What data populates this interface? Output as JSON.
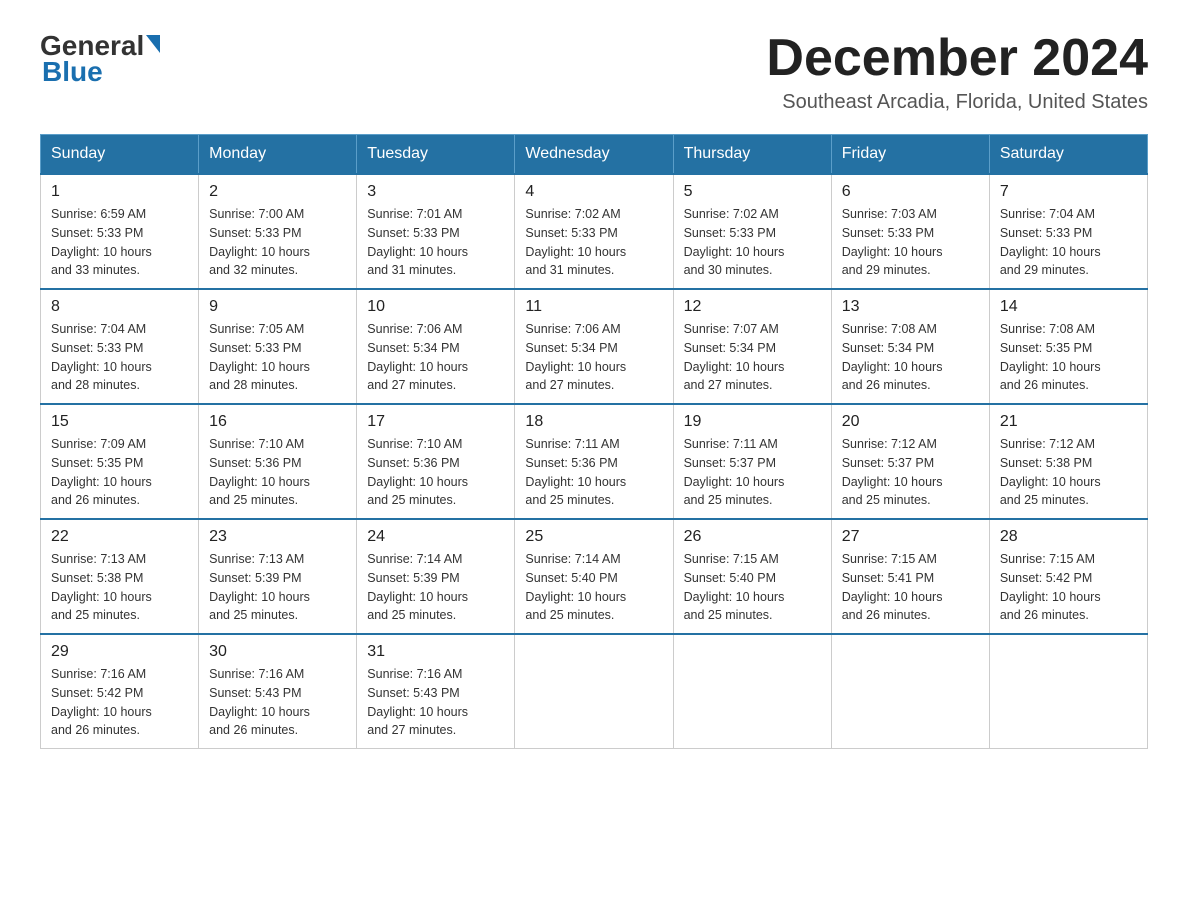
{
  "header": {
    "logo_general": "General",
    "logo_blue": "Blue",
    "month_title": "December 2024",
    "location": "Southeast Arcadia, Florida, United States"
  },
  "weekdays": [
    "Sunday",
    "Monday",
    "Tuesday",
    "Wednesday",
    "Thursday",
    "Friday",
    "Saturday"
  ],
  "weeks": [
    [
      {
        "day": "1",
        "sunrise": "6:59 AM",
        "sunset": "5:33 PM",
        "daylight": "10 hours and 33 minutes."
      },
      {
        "day": "2",
        "sunrise": "7:00 AM",
        "sunset": "5:33 PM",
        "daylight": "10 hours and 32 minutes."
      },
      {
        "day": "3",
        "sunrise": "7:01 AM",
        "sunset": "5:33 PM",
        "daylight": "10 hours and 31 minutes."
      },
      {
        "day": "4",
        "sunrise": "7:02 AM",
        "sunset": "5:33 PM",
        "daylight": "10 hours and 31 minutes."
      },
      {
        "day": "5",
        "sunrise": "7:02 AM",
        "sunset": "5:33 PM",
        "daylight": "10 hours and 30 minutes."
      },
      {
        "day": "6",
        "sunrise": "7:03 AM",
        "sunset": "5:33 PM",
        "daylight": "10 hours and 29 minutes."
      },
      {
        "day": "7",
        "sunrise": "7:04 AM",
        "sunset": "5:33 PM",
        "daylight": "10 hours and 29 minutes."
      }
    ],
    [
      {
        "day": "8",
        "sunrise": "7:04 AM",
        "sunset": "5:33 PM",
        "daylight": "10 hours and 28 minutes."
      },
      {
        "day": "9",
        "sunrise": "7:05 AM",
        "sunset": "5:33 PM",
        "daylight": "10 hours and 28 minutes."
      },
      {
        "day": "10",
        "sunrise": "7:06 AM",
        "sunset": "5:34 PM",
        "daylight": "10 hours and 27 minutes."
      },
      {
        "day": "11",
        "sunrise": "7:06 AM",
        "sunset": "5:34 PM",
        "daylight": "10 hours and 27 minutes."
      },
      {
        "day": "12",
        "sunrise": "7:07 AM",
        "sunset": "5:34 PM",
        "daylight": "10 hours and 27 minutes."
      },
      {
        "day": "13",
        "sunrise": "7:08 AM",
        "sunset": "5:34 PM",
        "daylight": "10 hours and 26 minutes."
      },
      {
        "day": "14",
        "sunrise": "7:08 AM",
        "sunset": "5:35 PM",
        "daylight": "10 hours and 26 minutes."
      }
    ],
    [
      {
        "day": "15",
        "sunrise": "7:09 AM",
        "sunset": "5:35 PM",
        "daylight": "10 hours and 26 minutes."
      },
      {
        "day": "16",
        "sunrise": "7:10 AM",
        "sunset": "5:36 PM",
        "daylight": "10 hours and 25 minutes."
      },
      {
        "day": "17",
        "sunrise": "7:10 AM",
        "sunset": "5:36 PM",
        "daylight": "10 hours and 25 minutes."
      },
      {
        "day": "18",
        "sunrise": "7:11 AM",
        "sunset": "5:36 PM",
        "daylight": "10 hours and 25 minutes."
      },
      {
        "day": "19",
        "sunrise": "7:11 AM",
        "sunset": "5:37 PM",
        "daylight": "10 hours and 25 minutes."
      },
      {
        "day": "20",
        "sunrise": "7:12 AM",
        "sunset": "5:37 PM",
        "daylight": "10 hours and 25 minutes."
      },
      {
        "day": "21",
        "sunrise": "7:12 AM",
        "sunset": "5:38 PM",
        "daylight": "10 hours and 25 minutes."
      }
    ],
    [
      {
        "day": "22",
        "sunrise": "7:13 AM",
        "sunset": "5:38 PM",
        "daylight": "10 hours and 25 minutes."
      },
      {
        "day": "23",
        "sunrise": "7:13 AM",
        "sunset": "5:39 PM",
        "daylight": "10 hours and 25 minutes."
      },
      {
        "day": "24",
        "sunrise": "7:14 AM",
        "sunset": "5:39 PM",
        "daylight": "10 hours and 25 minutes."
      },
      {
        "day": "25",
        "sunrise": "7:14 AM",
        "sunset": "5:40 PM",
        "daylight": "10 hours and 25 minutes."
      },
      {
        "day": "26",
        "sunrise": "7:15 AM",
        "sunset": "5:40 PM",
        "daylight": "10 hours and 25 minutes."
      },
      {
        "day": "27",
        "sunrise": "7:15 AM",
        "sunset": "5:41 PM",
        "daylight": "10 hours and 26 minutes."
      },
      {
        "day": "28",
        "sunrise": "7:15 AM",
        "sunset": "5:42 PM",
        "daylight": "10 hours and 26 minutes."
      }
    ],
    [
      {
        "day": "29",
        "sunrise": "7:16 AM",
        "sunset": "5:42 PM",
        "daylight": "10 hours and 26 minutes."
      },
      {
        "day": "30",
        "sunrise": "7:16 AM",
        "sunset": "5:43 PM",
        "daylight": "10 hours and 26 minutes."
      },
      {
        "day": "31",
        "sunrise": "7:16 AM",
        "sunset": "5:43 PM",
        "daylight": "10 hours and 27 minutes."
      },
      null,
      null,
      null,
      null
    ]
  ],
  "labels": {
    "sunrise": "Sunrise:",
    "sunset": "Sunset:",
    "daylight": "Daylight:"
  }
}
